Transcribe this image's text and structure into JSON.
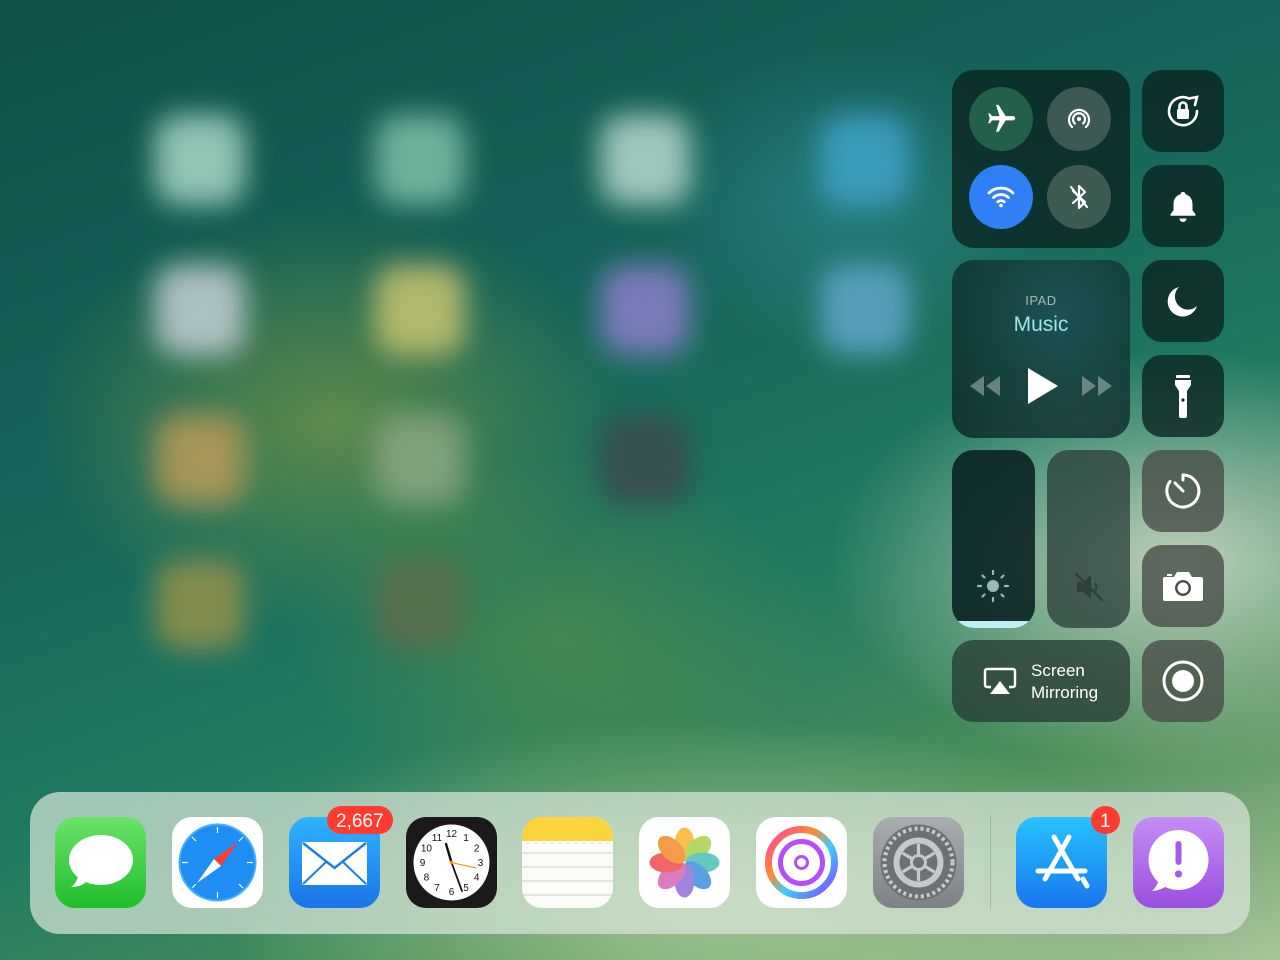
{
  "control_center": {
    "connectivity": {
      "airplane": "airplane-mode",
      "airdrop": "airdrop",
      "wifi": "wifi",
      "bluetooth": "bluetooth"
    },
    "music": {
      "source": "IPAD",
      "title": "Music"
    },
    "screen_mirroring": {
      "line1": "Screen",
      "line2": "Mirroring"
    },
    "brightness_level": 0.04,
    "volume_level": 0.0
  },
  "dock": {
    "badges": {
      "mail": "2,667",
      "app_store": "1"
    },
    "apps": [
      "Messages",
      "Safari",
      "Mail",
      "Clock",
      "Notes",
      "Photos",
      "Music Memos",
      "Settings",
      "App Store",
      "Feedback"
    ]
  },
  "clock_face": [
    "12",
    "1",
    "2",
    "3",
    "4",
    "5",
    "6",
    "7",
    "8",
    "9",
    "10",
    "11"
  ],
  "colors": {
    "wifi_active": "#2f7ff5",
    "badge": "#ff3b30",
    "tile": "#0a2320"
  }
}
